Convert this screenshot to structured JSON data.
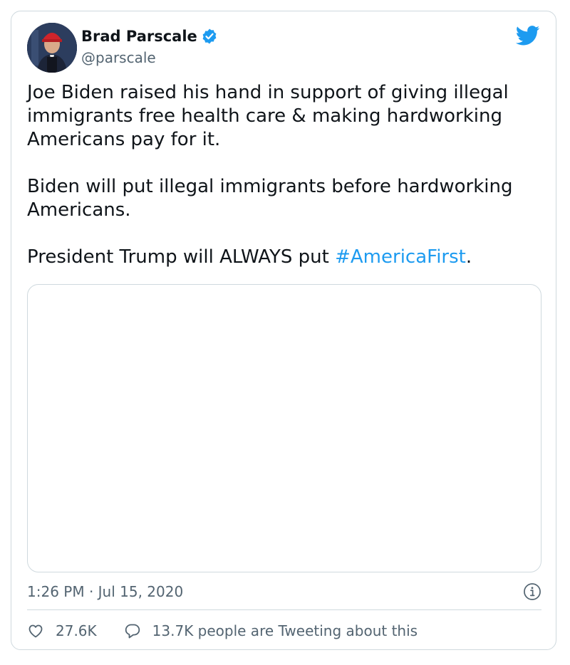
{
  "tweet": {
    "author": {
      "name": "Brad Parscale",
      "handle": "@parscale",
      "verified": true
    },
    "paragraphs": [
      "Joe Biden raised his hand in support of giving illegal immigrants free health care & making hardworking Americans pay for it.",
      "Biden will put illegal immigrants before hardworking Americans."
    ],
    "last_paragraph_prefix": "President Trump will ALWAYS put ",
    "hashtag": "#AmericaFirst",
    "last_paragraph_suffix": ".",
    "timestamp": "1:26 PM · Jul 15, 2020",
    "likes": "27.6K",
    "replies_text": "13.7K people are Tweeting about this"
  },
  "icons": {
    "brand": "twitter-bird-icon",
    "verified": "verified-badge-icon",
    "info": "info-icon",
    "like": "heart-icon",
    "reply": "speech-bubble-icon"
  },
  "colors": {
    "accent": "#1d9bf0",
    "text": "#0f1419",
    "secondary": "#536471",
    "border": "#cfd9de"
  }
}
